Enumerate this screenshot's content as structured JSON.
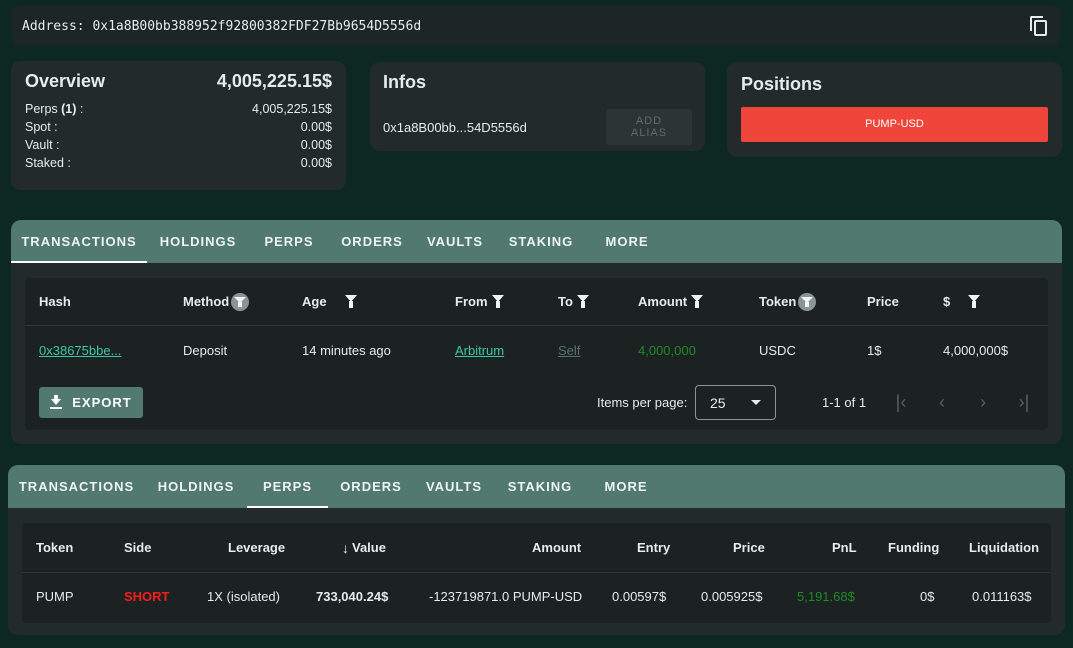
{
  "address": {
    "label": "Address: 0x1a8B00bb388952f92800382FDF27Bb9654D5556d",
    "copy_icon": "copy-icon"
  },
  "overview": {
    "title": "Overview",
    "total": "4,005,225.15$",
    "rows": [
      {
        "label_main": "Perps ",
        "label_bold": "(1)",
        "label_tail": " :",
        "value": "4,005,225.15$"
      },
      {
        "label_main": "Spot :",
        "label_bold": "",
        "label_tail": "",
        "value": "0.00$"
      },
      {
        "label_main": "Vault :",
        "label_bold": "",
        "label_tail": "",
        "value": "0.00$"
      },
      {
        "label_main": "Staked :",
        "label_bold": "",
        "label_tail": "",
        "value": "0.00$"
      }
    ]
  },
  "infos": {
    "title": "Infos",
    "short_address": "0x1a8B00bb...54D5556d",
    "add_alias": "ADD ALIAS"
  },
  "positions": {
    "title": "Positions",
    "items": [
      "PUMP-USD"
    ]
  },
  "panel1": {
    "tabs": [
      "TRANSACTIONS",
      "HOLDINGS",
      "PERPS",
      "ORDERS",
      "VAULTS",
      "STAKING",
      "MORE"
    ],
    "active_tab": "TRANSACTIONS",
    "headers": {
      "hash": "Hash",
      "method": "Method",
      "age": "Age",
      "from": "From",
      "to": "To",
      "amount": "Amount",
      "token": "Token",
      "price": "Price",
      "usd": "$"
    },
    "rows": [
      {
        "hash": "0x38675bbe...",
        "method": "Deposit",
        "age": "14 minutes ago",
        "from": "Arbitrum",
        "to": "Self",
        "amount": "4,000,000",
        "token": "USDC",
        "price": "1$",
        "usd": "4,000,000$"
      }
    ],
    "export_label": "EXPORT",
    "items_per_page_label": "Items per page:",
    "items_per_page_value": "25",
    "range": "1-1 of 1"
  },
  "panel2": {
    "tabs": [
      "TRANSACTIONS",
      "HOLDINGS",
      "PERPS",
      "ORDERS",
      "VAULTS",
      "STAKING",
      "MORE"
    ],
    "active_tab": "PERPS",
    "headers": {
      "token": "Token",
      "side": "Side",
      "leverage": "Leverage",
      "value": "Value",
      "amount": "Amount",
      "entry": "Entry",
      "price": "Price",
      "pnl": "PnL",
      "funding": "Funding",
      "liquidation": "Liquidation"
    },
    "rows": [
      {
        "token": "PUMP",
        "side": "SHORT",
        "leverage": "1X (isolated)",
        "value": "733,040.24$",
        "amount": "-123719871.0 PUMP-USD",
        "entry": "0.00597$",
        "price": "0.005925$",
        "pnl": "5,191.68$",
        "funding": "0$",
        "liquidation": "0.011163$"
      }
    ]
  },
  "colors": {
    "background": "#0c2820",
    "card": "#232b2a",
    "tab_bar": "#51796e",
    "position_button": "#f0453a",
    "link": "#3fc6a5",
    "short": "#f01e1e",
    "pnl_positive": "#1f8a2a"
  }
}
